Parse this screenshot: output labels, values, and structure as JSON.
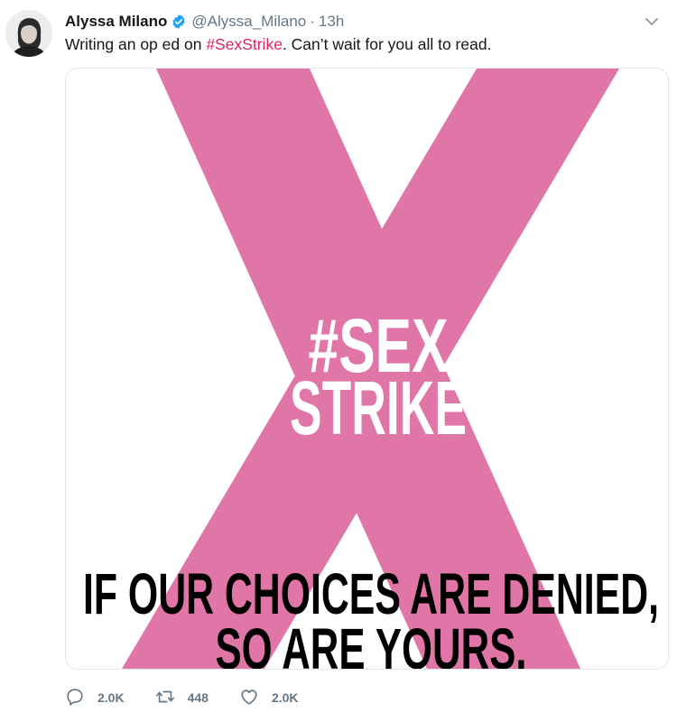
{
  "tweet": {
    "author_name": "Alyssa Milano",
    "handle": "@Alyssa_Milano",
    "separator": "·",
    "time": "13h",
    "text_before": "Writing an op ed on ",
    "hashtag": "#SexStrike",
    "text_after": ". Can’t wait for you all to read."
  },
  "image": {
    "hashtag_line1": "#SEX",
    "hashtag_line2": "STRIKE",
    "slogan_line1": "IF OUR CHOICES ARE DENIED,",
    "slogan_line2": "SO ARE YOURS.",
    "x_color": "#e075a8"
  },
  "actions": {
    "reply_count": "2.0K",
    "retweet_count": "448",
    "like_count": "2.0K"
  },
  "colors": {
    "hashtag": "#e0245e",
    "verified": "#1da1f2",
    "muted": "#657786"
  },
  "icons": [
    "avatar",
    "verified-badge-icon",
    "chevron-down-icon",
    "reply-icon",
    "retweet-icon",
    "like-icon"
  ]
}
